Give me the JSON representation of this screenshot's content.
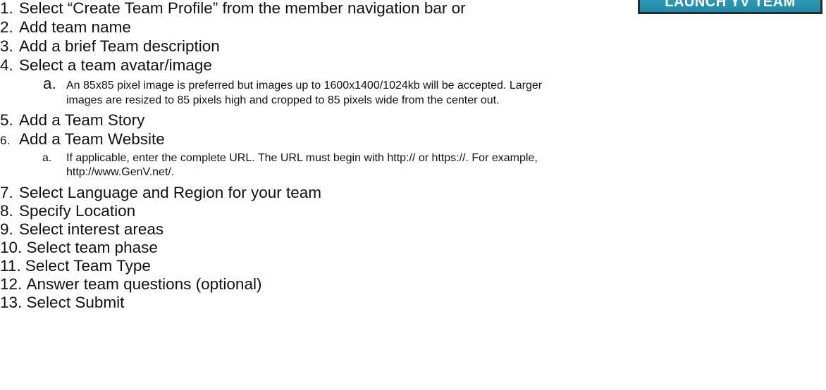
{
  "launch_button": {
    "label": "LAUNCH YV TEAM",
    "bg_color": "#2a93b2"
  },
  "steps": [
    {
      "num": "1.",
      "text": "Select “Create Team Profile” from the member navigation bar or"
    },
    {
      "num": "2.",
      "text": "Add team name"
    },
    {
      "num": "3.",
      "text": "Add a brief Team description"
    },
    {
      "num": "4.",
      "text": "Select a team avatar/image"
    },
    {
      "num": "5.",
      "text": "Add a Team Story"
    },
    {
      "num": "6.",
      "text": "Add a Team Website"
    },
    {
      "num": "7.",
      "text": "Select Language and Region for your team"
    },
    {
      "num": "8.",
      "text": "Specify Location"
    },
    {
      "num": "9.",
      "text": "Select interest areas"
    },
    {
      "num": "10.",
      "text": "Select team phase"
    },
    {
      "num": "11.",
      "text": "Select Team Type"
    },
    {
      "num": "12.",
      "text": "Answer team questions (optional)"
    },
    {
      "num": "13.",
      "text": "Select Submit"
    }
  ],
  "substeps": {
    "avatar": {
      "marker": "a.",
      "line1": "An 85x85 pixel image is preferred but images up to 1600x1400/1024kb will be accepted. Larger",
      "line2": "images are resized to 85 pixels high and cropped to 85 pixels wide from the center out."
    },
    "website": {
      "marker": "a.",
      "line1": "If applicable, enter the complete URL. The URL must begin with http:// or https://. For example,",
      "line2": "http://www.GenV.net/."
    }
  }
}
